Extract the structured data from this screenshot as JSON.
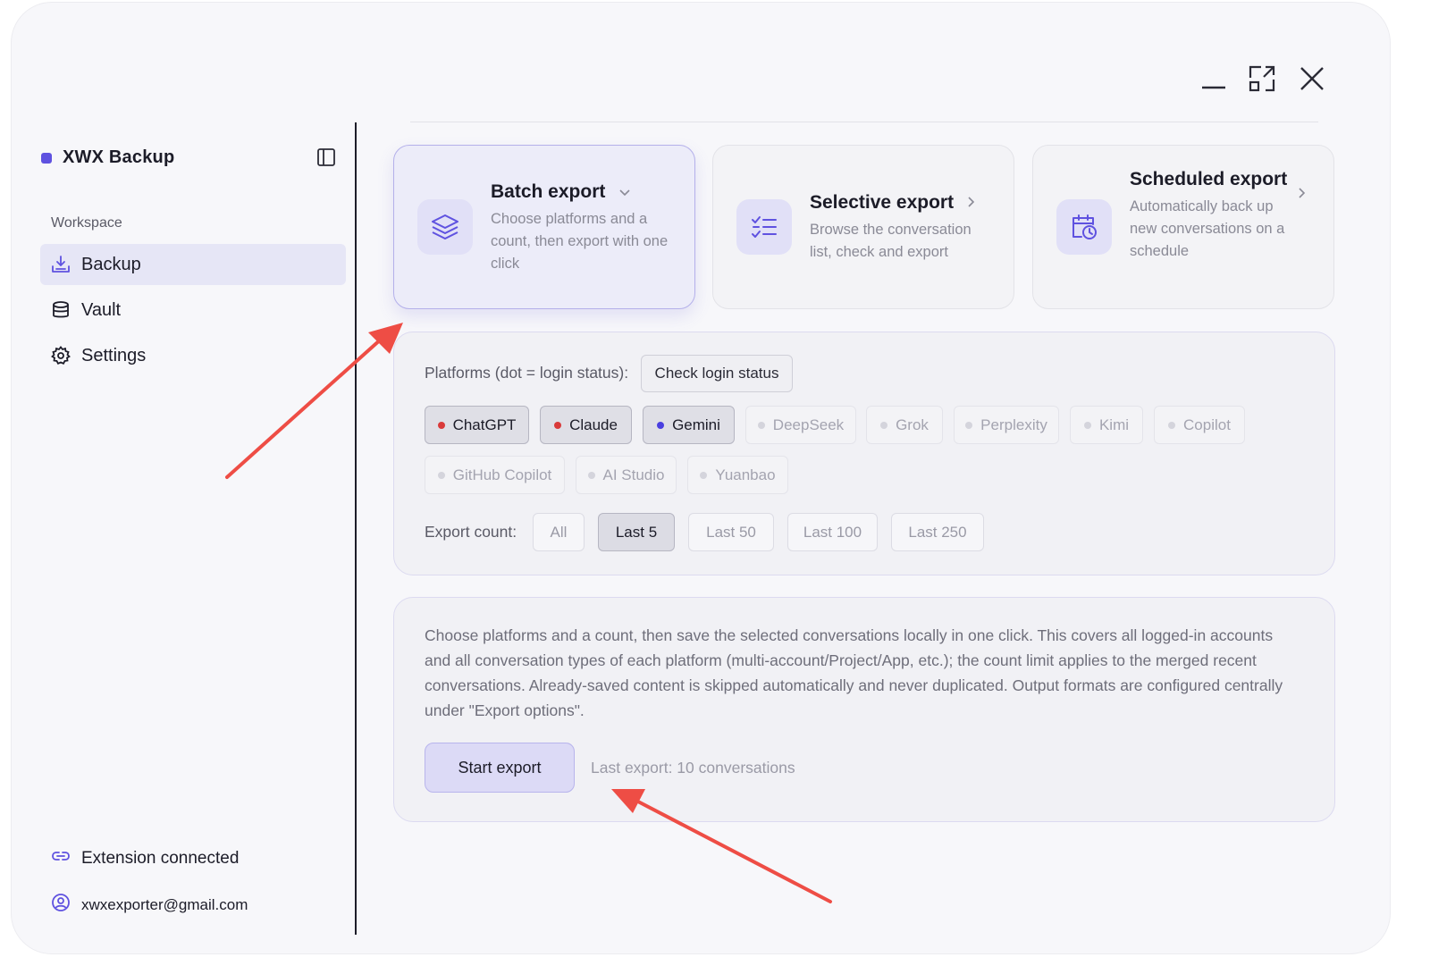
{
  "window": {
    "minimize_icon": "minimize-icon",
    "maximize_icon": "maximize-icon",
    "close_icon": "close-icon"
  },
  "sidebar": {
    "brand": "XWX Backup",
    "brand_color": "#5f52e0",
    "section_label": "Workspace",
    "items": [
      {
        "label": "Backup",
        "icon": "download-tray-icon",
        "active": true
      },
      {
        "label": "Vault",
        "icon": "database-icon",
        "active": false
      },
      {
        "label": "Settings",
        "icon": "gear-icon",
        "active": false
      }
    ],
    "footer": {
      "connection": "Extension connected",
      "email": "xwxexporter@gmail.com"
    }
  },
  "modes": [
    {
      "title": "Batch export",
      "desc": "Choose platforms and a count, then export with one click",
      "icon": "layers-icon",
      "chevron": "chevron-down-icon",
      "active": true
    },
    {
      "title": "Selective export",
      "desc": "Browse the conversation list, check and export",
      "icon": "checklist-icon",
      "chevron": "chevron-right-icon",
      "active": false
    },
    {
      "title": "Scheduled export",
      "desc": "Automatically back up new conversations on a schedule",
      "icon": "calendar-clock-icon",
      "chevron": "chevron-right-icon",
      "active": false
    }
  ],
  "platforms": {
    "label": "Platforms (dot = login status):",
    "check_button": "Check login status",
    "chips": [
      {
        "name": "ChatGPT",
        "selected": true,
        "dot_color": "#d93a3a"
      },
      {
        "name": "Claude",
        "selected": true,
        "dot_color": "#d93a3a"
      },
      {
        "name": "Gemini",
        "selected": true,
        "dot_color": "#4a3fe0"
      },
      {
        "name": "DeepSeek",
        "selected": false,
        "dot_color": "#d4d4dc"
      },
      {
        "name": "Grok",
        "selected": false,
        "dot_color": "#d4d4dc"
      },
      {
        "name": "Perplexity",
        "selected": false,
        "dot_color": "#d4d4dc"
      },
      {
        "name": "Kimi",
        "selected": false,
        "dot_color": "#d4d4dc"
      },
      {
        "name": "Copilot",
        "selected": false,
        "dot_color": "#d4d4dc"
      },
      {
        "name": "GitHub Copilot",
        "selected": false,
        "dot_color": "#d4d4dc"
      },
      {
        "name": "AI Studio",
        "selected": false,
        "dot_color": "#d4d4dc"
      },
      {
        "name": "Yuanbao",
        "selected": false,
        "dot_color": "#d4d4dc"
      }
    ]
  },
  "export_count": {
    "label": "Export count:",
    "options": [
      {
        "label": "All",
        "selected": false
      },
      {
        "label": "Last 5",
        "selected": true
      },
      {
        "label": "Last 50",
        "selected": false
      },
      {
        "label": "Last 100",
        "selected": false
      },
      {
        "label": "Last 250",
        "selected": false
      }
    ]
  },
  "info": {
    "text": "Choose platforms and a count, then save the selected conversations locally in one click. This covers all logged-in accounts and all conversation types of each platform (multi-account/Project/App, etc.); the count limit applies to the merged recent conversations. Already-saved content is skipped automatically and never duplicated. Output formats are configured centrally under \"Export options\".",
    "start_button": "Start export",
    "last_export": "Last export: 10 conversations"
  },
  "colors": {
    "accent": "#5f52e0",
    "annotation_arrow": "#ee4d45"
  }
}
